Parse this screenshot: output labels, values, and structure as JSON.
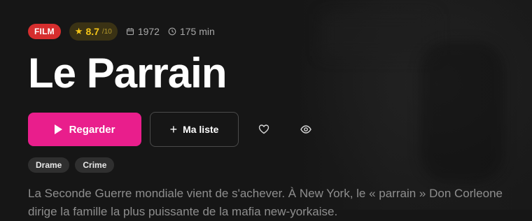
{
  "meta": {
    "type_badge": "FILM",
    "rating_score": "8.7",
    "rating_scale": "/10",
    "year": "1972",
    "duration": "175 min"
  },
  "title": "Le Parrain",
  "actions": {
    "watch_label": "Regarder",
    "list_label": "Ma liste"
  },
  "tags": [
    "Drame",
    "Crime"
  ],
  "synopsis": "La Seconde Guerre mondiale vient de s'achever. À New York, le « parrain » Don Corleone dirige la famille la plus puissante de la mafia new-yorkaise.",
  "colors": {
    "accent": "#e91e8c",
    "badge": "#d62e2e",
    "rating": "#f5c518",
    "background": "#161616"
  },
  "icons": [
    "star-icon",
    "calendar-icon",
    "clock-icon",
    "play-icon",
    "plus-icon",
    "heart-icon",
    "eye-icon"
  ]
}
